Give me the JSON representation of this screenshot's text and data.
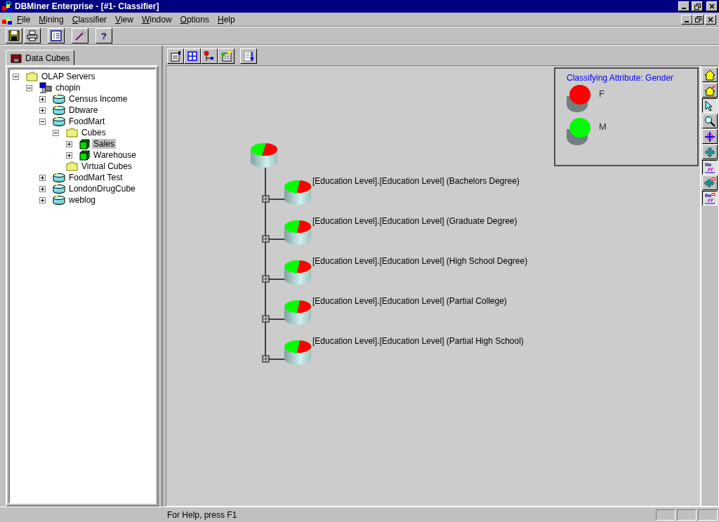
{
  "window": {
    "title": "DBMiner Enterprise - [#1- Classifier]"
  },
  "menu": [
    {
      "label": "File"
    },
    {
      "label": "Mining"
    },
    {
      "label": "Classifier"
    },
    {
      "label": "View"
    },
    {
      "label": "Window"
    },
    {
      "label": "Options"
    },
    {
      "label": "Help"
    }
  ],
  "help_button": "?",
  "sidebar": {
    "tab": "Data Cubes",
    "tree": [
      {
        "label": "OLAP Servers",
        "kind": "folder",
        "expanded": true,
        "selected": false,
        "children": [
          {
            "label": "chopin",
            "kind": "server",
            "expanded": true,
            "selected": false,
            "children": [
              {
                "label": "Census Income",
                "kind": "database",
                "expanded": false,
                "selected": false
              },
              {
                "label": "Dbware",
                "kind": "database",
                "expanded": false,
                "selected": false
              },
              {
                "label": "FoodMart",
                "kind": "database",
                "expanded": true,
                "selected": false,
                "children": [
                  {
                    "label": "Cubes",
                    "kind": "folder",
                    "expanded": true,
                    "selected": false,
                    "children": [
                      {
                        "label": "Sales",
                        "kind": "cube",
                        "expanded": false,
                        "selected": true
                      },
                      {
                        "label": "Warehouse",
                        "kind": "cube",
                        "expanded": false,
                        "selected": false
                      }
                    ]
                  },
                  {
                    "label": "Virtual Cubes",
                    "kind": "folder",
                    "selected": false
                  }
                ]
              },
              {
                "label": "FoodMart Test",
                "kind": "database",
                "expanded": false,
                "selected": false
              },
              {
                "label": "LondonDrugCube",
                "kind": "database",
                "expanded": false,
                "selected": false
              },
              {
                "label": "weblog",
                "kind": "database",
                "expanded": false,
                "selected": false
              }
            ]
          }
        ]
      }
    ]
  },
  "legend": {
    "title": "Classifying Attribute: Gender",
    "items": [
      {
        "label": "F",
        "color": "#ff0000"
      },
      {
        "label": "M",
        "color": "#00ff00"
      }
    ]
  },
  "tree_diagram": {
    "nodes": [
      {
        "label": "[Education Level].[Education Level] (Bachelors Degree)"
      },
      {
        "label": "[Education Level].[Education Level] (Graduate Degree)"
      },
      {
        "label": "[Education Level].[Education Level] (High School Degree)"
      },
      {
        "label": "[Education Level].[Education Level] (Partial College)"
      },
      {
        "label": "[Education Level].[Education Level] (Partial High School)"
      }
    ]
  },
  "side_tools": [
    {
      "kind": "home",
      "pressed": false
    },
    {
      "kind": "home-arrow",
      "pressed": false
    },
    {
      "kind": "pointer",
      "pressed": true
    },
    {
      "kind": "zoom",
      "pressed": false
    },
    {
      "kind": "rotate",
      "pressed": false
    },
    {
      "kind": "move",
      "pressed": false
    },
    {
      "kind": "onoff",
      "pressed": true
    },
    {
      "kind": "move-flag",
      "pressed": false
    },
    {
      "kind": "onoff-flag",
      "pressed": true
    }
  ],
  "status_bar": {
    "text": "For Help, press F1"
  }
}
